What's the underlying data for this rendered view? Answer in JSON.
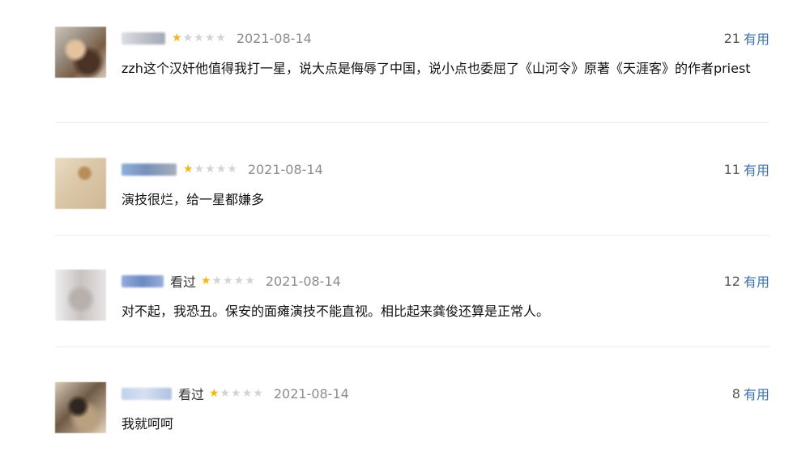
{
  "comments": [
    {
      "watched": "",
      "rating": 1,
      "date": "2021-08-14",
      "votes": "21",
      "useful_label": "有用",
      "text": "zzh这个汉奸他值得我打一星，说大点是侮辱了中国，说小点也委屈了《山河令》原著《天涯客》的作者priest"
    },
    {
      "watched": "",
      "rating": 1,
      "date": "2021-08-14",
      "votes": "11",
      "useful_label": "有用",
      "text": "演技很烂，给一星都嫌多"
    },
    {
      "watched": "看过",
      "rating": 1,
      "date": "2021-08-14",
      "votes": "12",
      "useful_label": "有用",
      "text": "对不起，我恐丑。保安的面瘫演技不能直视。相比起来龚俊还算是正常人。"
    },
    {
      "watched": "看过",
      "rating": 1,
      "date": "2021-08-14",
      "votes": "8",
      "useful_label": "有用",
      "text": "我就呵呵"
    }
  ],
  "colors": {
    "star_on": "#f5b51c",
    "star_off": "#d3d3d3",
    "useful_link": "#3c73ac",
    "date_text": "#8c8c8c",
    "divider": "#ececec"
  }
}
